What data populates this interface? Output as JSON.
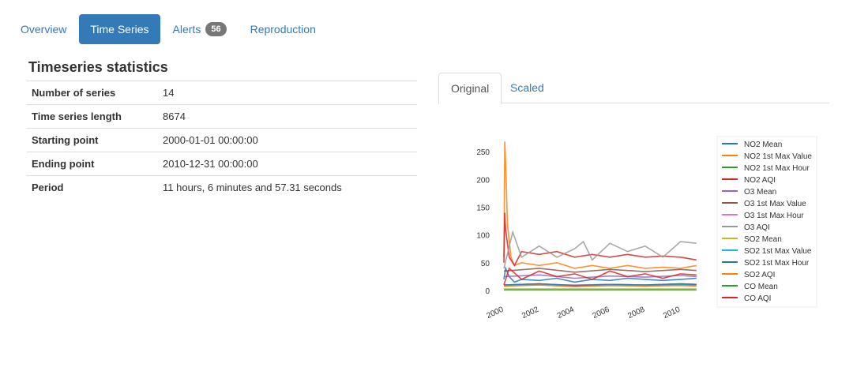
{
  "nav": {
    "tabs": [
      {
        "label": "Overview"
      },
      {
        "label": "Time Series"
      },
      {
        "label": "Alerts"
      },
      {
        "label": "Reproduction"
      }
    ],
    "active_index": 1,
    "alerts_count": "56"
  },
  "stats": {
    "title": "Timeseries statistics",
    "rows": [
      {
        "key": "Number of series",
        "value": "14"
      },
      {
        "key": "Time series length",
        "value": "8674"
      },
      {
        "key": "Starting point",
        "value": "2000-01-01 00:00:00"
      },
      {
        "key": "Ending point",
        "value": "2010-12-31 00:00:00"
      },
      {
        "key": "Period",
        "value": "11 hours, 6 minutes and 57.31 seconds"
      }
    ]
  },
  "chart_tabs": {
    "original": "Original",
    "scaled": "Scaled",
    "active": "Original"
  },
  "chart_data": {
    "type": "line",
    "title": "",
    "xlabel": "",
    "ylabel": "",
    "xlim": [
      2000,
      2011
    ],
    "ylim": [
      0,
      270
    ],
    "x_ticks": [
      "2000",
      "2002",
      "2004",
      "2006",
      "2008",
      "2010"
    ],
    "y_ticks": [
      0,
      50,
      100,
      150,
      200,
      250
    ],
    "legend_position": "right",
    "series": [
      {
        "name": "NO2 Mean",
        "color": "#1f77b4",
        "x": [
          2000.0,
          2000.1,
          2000.3,
          2000.6,
          2001,
          2002,
          2003,
          2004,
          2005,
          2006,
          2007,
          2008,
          2009,
          2010,
          2010.9
        ],
        "values": [
          20,
          40,
          25,
          15,
          20,
          18,
          22,
          15,
          20,
          18,
          22,
          20,
          18,
          20,
          22
        ]
      },
      {
        "name": "NO2 1st Max Value",
        "color": "#ff7f0e",
        "x": [
          2000.0,
          2000.05,
          2000.1,
          2000.2,
          2000.4,
          2000.6,
          2001,
          2002,
          2003,
          2004,
          2005,
          2006,
          2007,
          2008,
          2009,
          2010,
          2010.9
        ],
        "values": [
          60,
          268,
          230,
          120,
          60,
          45,
          50,
          45,
          50,
          40,
          45,
          40,
          45,
          40,
          42,
          40,
          45
        ]
      },
      {
        "name": "NO2 1st Max Hour",
        "color": "#2ca02c",
        "x": [
          2000.0,
          2002,
          2004,
          2006,
          2008,
          2010,
          2010.9
        ],
        "values": [
          10,
          12,
          9,
          11,
          10,
          12,
          11
        ]
      },
      {
        "name": "NO2 AQI",
        "color": "#d62728",
        "x": [
          2000.0,
          2000.05,
          2000.1,
          2000.3,
          2000.6,
          2001,
          2002,
          2003,
          2004,
          2005,
          2006,
          2007,
          2008,
          2009,
          2010,
          2010.9
        ],
        "values": [
          50,
          140,
          110,
          60,
          45,
          70,
          65,
          70,
          60,
          65,
          60,
          65,
          60,
          62,
          60,
          55
        ]
      },
      {
        "name": "O3 Mean",
        "color": "#9467bd",
        "x": [
          2000.0,
          2002,
          2004,
          2006,
          2008,
          2010,
          2010.9
        ],
        "values": [
          25,
          28,
          22,
          26,
          24,
          27,
          25
        ]
      },
      {
        "name": "O3 1st Max Value",
        "color": "#8c564b",
        "x": [
          2000.0,
          2002,
          2004,
          2006,
          2008,
          2010,
          2010.9
        ],
        "values": [
          35,
          40,
          33,
          38,
          34,
          38,
          36
        ]
      },
      {
        "name": "O3 1st Max Hour",
        "color": "#e377c2",
        "x": [
          2000.0,
          2002,
          2004,
          2006,
          2008,
          2010,
          2010.9
        ],
        "values": [
          10,
          11,
          10,
          11,
          10,
          11,
          10
        ]
      },
      {
        "name": "O3 AQI",
        "color": "#999999",
        "x": [
          2000.0,
          2000.5,
          2001,
          2002,
          2003,
          2004,
          2004.5,
          2005,
          2006,
          2007,
          2008,
          2009,
          2010,
          2010.9
        ],
        "values": [
          40,
          105,
          60,
          80,
          60,
          75,
          88,
          55,
          85,
          70,
          80,
          60,
          88,
          85
        ]
      },
      {
        "name": "SO2 Mean",
        "color": "#bcbd22",
        "x": [
          2000.0,
          2010.9
        ],
        "values": [
          3,
          3
        ]
      },
      {
        "name": "SO2 1st Max Value",
        "color": "#17becf",
        "x": [
          2000.0,
          2002,
          2004,
          2006,
          2008,
          2010,
          2010.9
        ],
        "values": [
          8,
          10,
          7,
          9,
          8,
          10,
          9
        ]
      },
      {
        "name": "SO2 1st Max Hour",
        "color": "#1f77b4",
        "x": [
          2000.0,
          2002,
          2004,
          2006,
          2008,
          2010,
          2010.9
        ],
        "values": [
          10,
          12,
          9,
          11,
          10,
          12,
          11
        ]
      },
      {
        "name": "SO2 AQI",
        "color": "#ff7f0e",
        "x": [
          2000.0,
          2002,
          2004,
          2006,
          2008,
          2010,
          2010.9
        ],
        "values": [
          8,
          10,
          7,
          9,
          8,
          9,
          8
        ]
      },
      {
        "name": "CO Mean",
        "color": "#2ca02c",
        "x": [
          2000.0,
          2010.9
        ],
        "values": [
          1,
          1
        ]
      },
      {
        "name": "CO AQI",
        "color": "#d62728",
        "x": [
          2000.0,
          2000.3,
          2001,
          2002,
          2003,
          2004,
          2005,
          2006,
          2007,
          2008,
          2009,
          2010,
          2010.9
        ],
        "values": [
          10,
          40,
          20,
          35,
          25,
          30,
          20,
          35,
          25,
          30,
          22,
          30,
          28
        ]
      }
    ]
  }
}
